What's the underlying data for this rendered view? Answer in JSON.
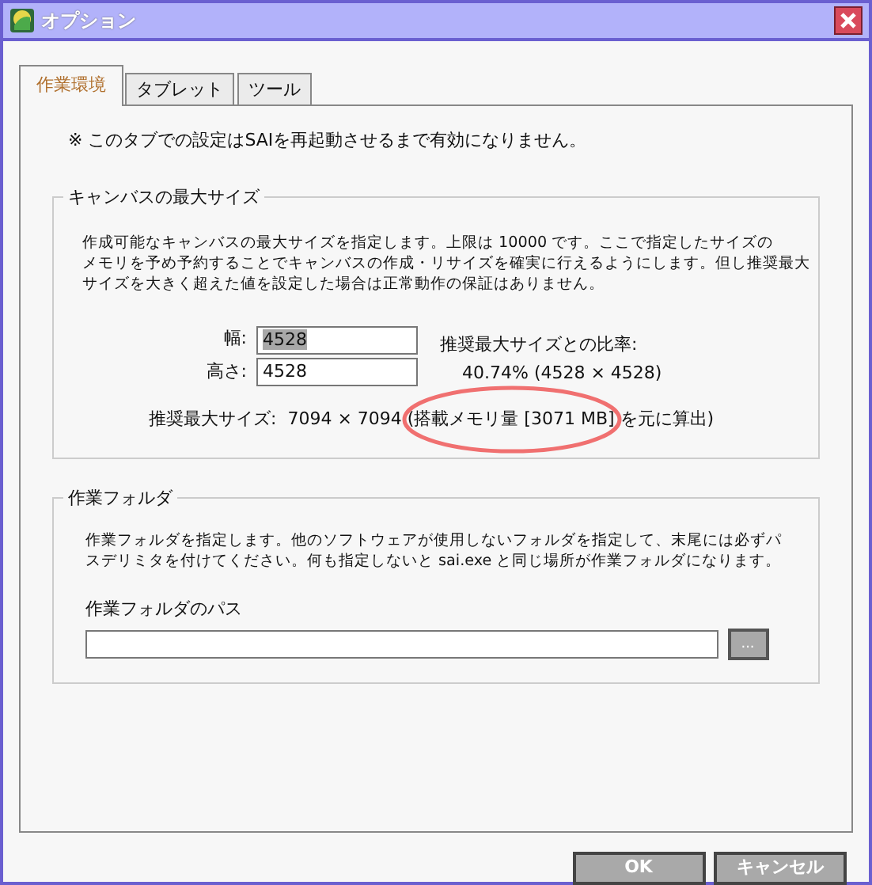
{
  "window": {
    "title": "オプション"
  },
  "tabs": [
    {
      "label": "作業環境",
      "selected": true
    },
    {
      "label": "タブレット",
      "selected": false
    },
    {
      "label": "ツール",
      "selected": false
    }
  ],
  "notice": "※ このタブでの設定はSAIを再起動させるまで有効になりません。",
  "canvas_group": {
    "title": "キャンバスの最大サイズ",
    "description_lines": [
      "作成可能なキャンバスの最大サイズを指定します。上限は 10000 です。ここで指定したサイズの",
      "メモリを予め予約することでキャンバスの作成・リサイズを確実に行えるようにします。但し推奨最大",
      "サイズを大きく超えた値を設定した場合は正常動作の保証はありません。"
    ],
    "fields": [
      {
        "label": "幅:",
        "value": "4528",
        "highlighted": true
      },
      {
        "label": "高さ:",
        "value": "4528",
        "highlighted": false
      }
    ],
    "ratio_label": "推奨最大サイズとの比率:",
    "ratio_value": "40.74% (4528 × 4528)",
    "recommended": "推奨最大サイズ:  7094 × 7094 (搭載メモリ量 [3071 MB] を元に算出)"
  },
  "folder_group": {
    "title": "作業フォルダ",
    "description_lines": [
      "作業フォルダを指定します。他のソフトウェアが使用しないフォルダを指定して、末尾には必ずパ",
      "スデリミタを付けてください。何も指定しないと sai.exe と同じ場所が作業フォルダになります。"
    ],
    "path_label": "作業フォルダのパス",
    "browse_button": "..."
  },
  "buttons": [
    {
      "label": "OK"
    },
    {
      "label": "キャンセル"
    }
  ],
  "annotations": [
    {
      "kind": "ellipse",
      "color": "#f07070"
    }
  ]
}
